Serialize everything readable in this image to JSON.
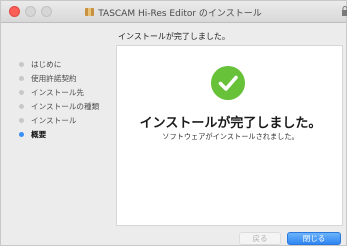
{
  "window": {
    "title": "TASCAM Hi-Res Editor のインストール",
    "subheader": "インストールが完了しました。"
  },
  "sidebar": {
    "items": [
      {
        "label": "はじめに",
        "active": false
      },
      {
        "label": "使用許諾契約",
        "active": false
      },
      {
        "label": "インストール先",
        "active": false
      },
      {
        "label": "インストールの種類",
        "active": false
      },
      {
        "label": "インストール",
        "active": false
      },
      {
        "label": "概要",
        "active": true
      }
    ]
  },
  "main": {
    "heading": "インストールが完了しました。",
    "message": "ソフトウェアがインストールされました。",
    "check_icon": "checkmark-circle-icon",
    "check_color": "#67c23a"
  },
  "buttons": {
    "back_label": "戻る",
    "close_label": "閉じる"
  },
  "colors": {
    "accent": "#3a8ef7",
    "primary_button": "#2f86f2"
  }
}
